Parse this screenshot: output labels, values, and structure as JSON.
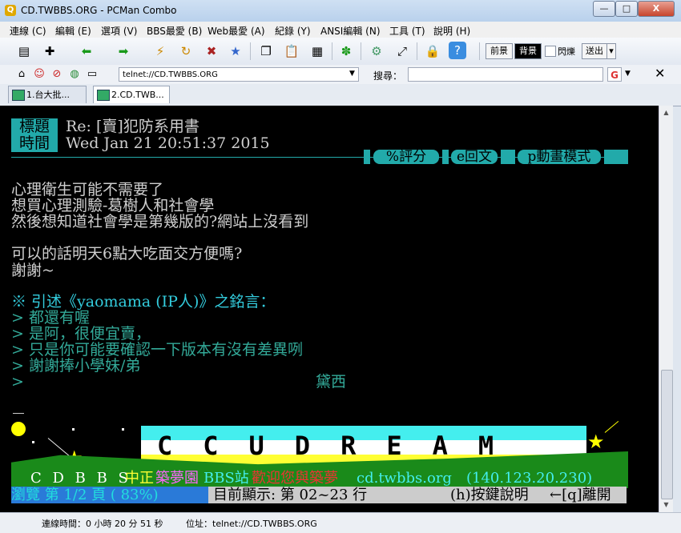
{
  "window": {
    "title": "CD.TWBBS.ORG - PCMan Combo",
    "btn_min": "—",
    "btn_max": "□",
    "btn_close": "X"
  },
  "menu": [
    "連線 (C)",
    "編輯 (E)",
    "選項 (V)",
    "BBS最愛 (B)",
    "Web最愛 (A)",
    "紀錄 (Y)",
    "ANSI編輯 (N)",
    "工具 (T)",
    "說明 (H)"
  ],
  "toolbar": {
    "fg_label": "前景",
    "bg_label": "背景",
    "blink_label": "閃爍",
    "send_label": "送出"
  },
  "address": {
    "value": "telnet://CD.TWBBS.ORG",
    "search_label": "搜尋：",
    "search_value": ""
  },
  "tabs": [
    {
      "label": "1.台大批..."
    },
    {
      "label": "2.CD.TWB..."
    }
  ],
  "article": {
    "title_label": "標題",
    "title_value": "Re: [賣]犯防系用書",
    "time_label": "時間",
    "time_value": "Wed Jan 21 20:51:37 2015",
    "actions": [
      "%評分",
      "e回文",
      "p動畫模式"
    ],
    "body": [
      "心理衛生可能不需要了",
      "想買心理測驗-葛樹人和社會學",
      "然後想知道社會學是第幾版的?網站上沒看到",
      "",
      "可以的話明天6點大吃面交方便嗎?",
      "謝謝~"
    ],
    "quote_header": "※ 引述《yaomama (IP人)》之銘言：",
    "quotes": [
      "> 都還有喔",
      "> 是阿，很便宜賣，",
      "> 只是你可能要確認一下版本有沒有差異咧",
      "> 謝謝捧小學妹/弟",
      ">"
    ],
    "signature_name": "黛西"
  },
  "banner": {
    "logo": "CCUDREAM",
    "site_name": "C D B B S",
    "station_a": "中正",
    "station_b": "築夢園",
    "station_c": "BBS站",
    "motto": "歡迎您與築夢",
    "host": "cd.twbbs.org",
    "ip": "(140.123.20.230)"
  },
  "footer": {
    "browse": "瀏覽 第 1/2 頁 ( 83%)",
    "showing": "目前顯示: 第 02~23 行",
    "help": "(h)按鍵說明",
    "leave": "←[q]離開"
  },
  "status": {
    "conn_time": "連線時間：0 小時 20 分 51 秒",
    "location": "位址：telnet://CD.TWBBS.ORG"
  }
}
